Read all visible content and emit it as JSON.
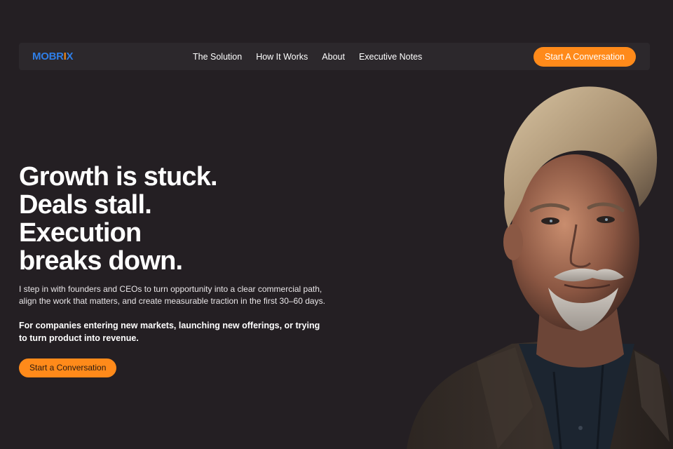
{
  "brand": {
    "logo_text_a": "MOBR",
    "logo_text_mark": "I",
    "logo_text_b": "X",
    "colors": {
      "accent": "#ff8a1a",
      "logo": "#2f7ee6",
      "background": "#241f23"
    }
  },
  "nav": {
    "links": [
      {
        "label": "The Solution"
      },
      {
        "label": "How It Works"
      },
      {
        "label": "About"
      },
      {
        "label": "Executive Notes"
      }
    ],
    "cta_label": "Start A Conversation"
  },
  "hero": {
    "headline": [
      "Growth is stuck.",
      "Deals stall.",
      "Execution",
      "breaks down."
    ],
    "subtext": "I step in with founders and CEOs to turn opportunity into a clear commercial path, align the work that matters, and create measurable traction in the first 30–60 days.",
    "audience": "For companies entering new markets, launching new offerings, or trying to turn product into revenue.",
    "cta_label": "Start a Conversation"
  },
  "portrait": {
    "icon": "person-portrait-photo"
  }
}
